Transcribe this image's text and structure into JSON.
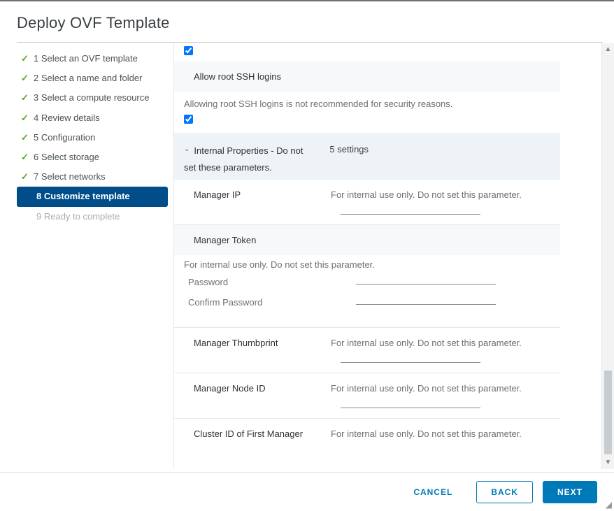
{
  "title": "Deploy OVF Template",
  "steps": {
    "s1": "1 Select an OVF template",
    "s2": "2 Select a name and folder",
    "s3": "3 Select a compute resource",
    "s4": "4 Review details",
    "s5": "5 Configuration",
    "s6": "6 Select storage",
    "s7": "7 Select networks",
    "s8": "8 Customize template",
    "s9": "9 Ready to complete"
  },
  "form": {
    "allow_ssh_label": "Allow root SSH logins",
    "allow_ssh_note": "Allowing root SSH logins is not recommended for security reasons.",
    "group_title_line1": "Internal Properties - Do not",
    "group_title_line2": "set these parameters.",
    "group_count": "5 settings",
    "manager_ip_label": "Manager IP",
    "manager_ip_desc": "For internal use only. Do not set this parameter.",
    "manager_token_label": "Manager Token",
    "manager_token_note": "For internal use only. Do not set this parameter.",
    "password_label": "Password",
    "confirm_password_label": "Confirm Password",
    "manager_thumb_label": "Manager Thumbprint",
    "manager_thumb_desc": "For internal use only. Do not set this parameter.",
    "manager_node_label": "Manager Node ID",
    "manager_node_desc": "For internal use only. Do not set this parameter.",
    "cluster_id_label": "Cluster ID of First Manager",
    "cluster_id_desc": "For internal use only. Do not set this parameter."
  },
  "buttons": {
    "cancel": "CANCEL",
    "back": "BACK",
    "next": "NEXT"
  },
  "scroll": {
    "up": "▲",
    "down": "▼"
  }
}
